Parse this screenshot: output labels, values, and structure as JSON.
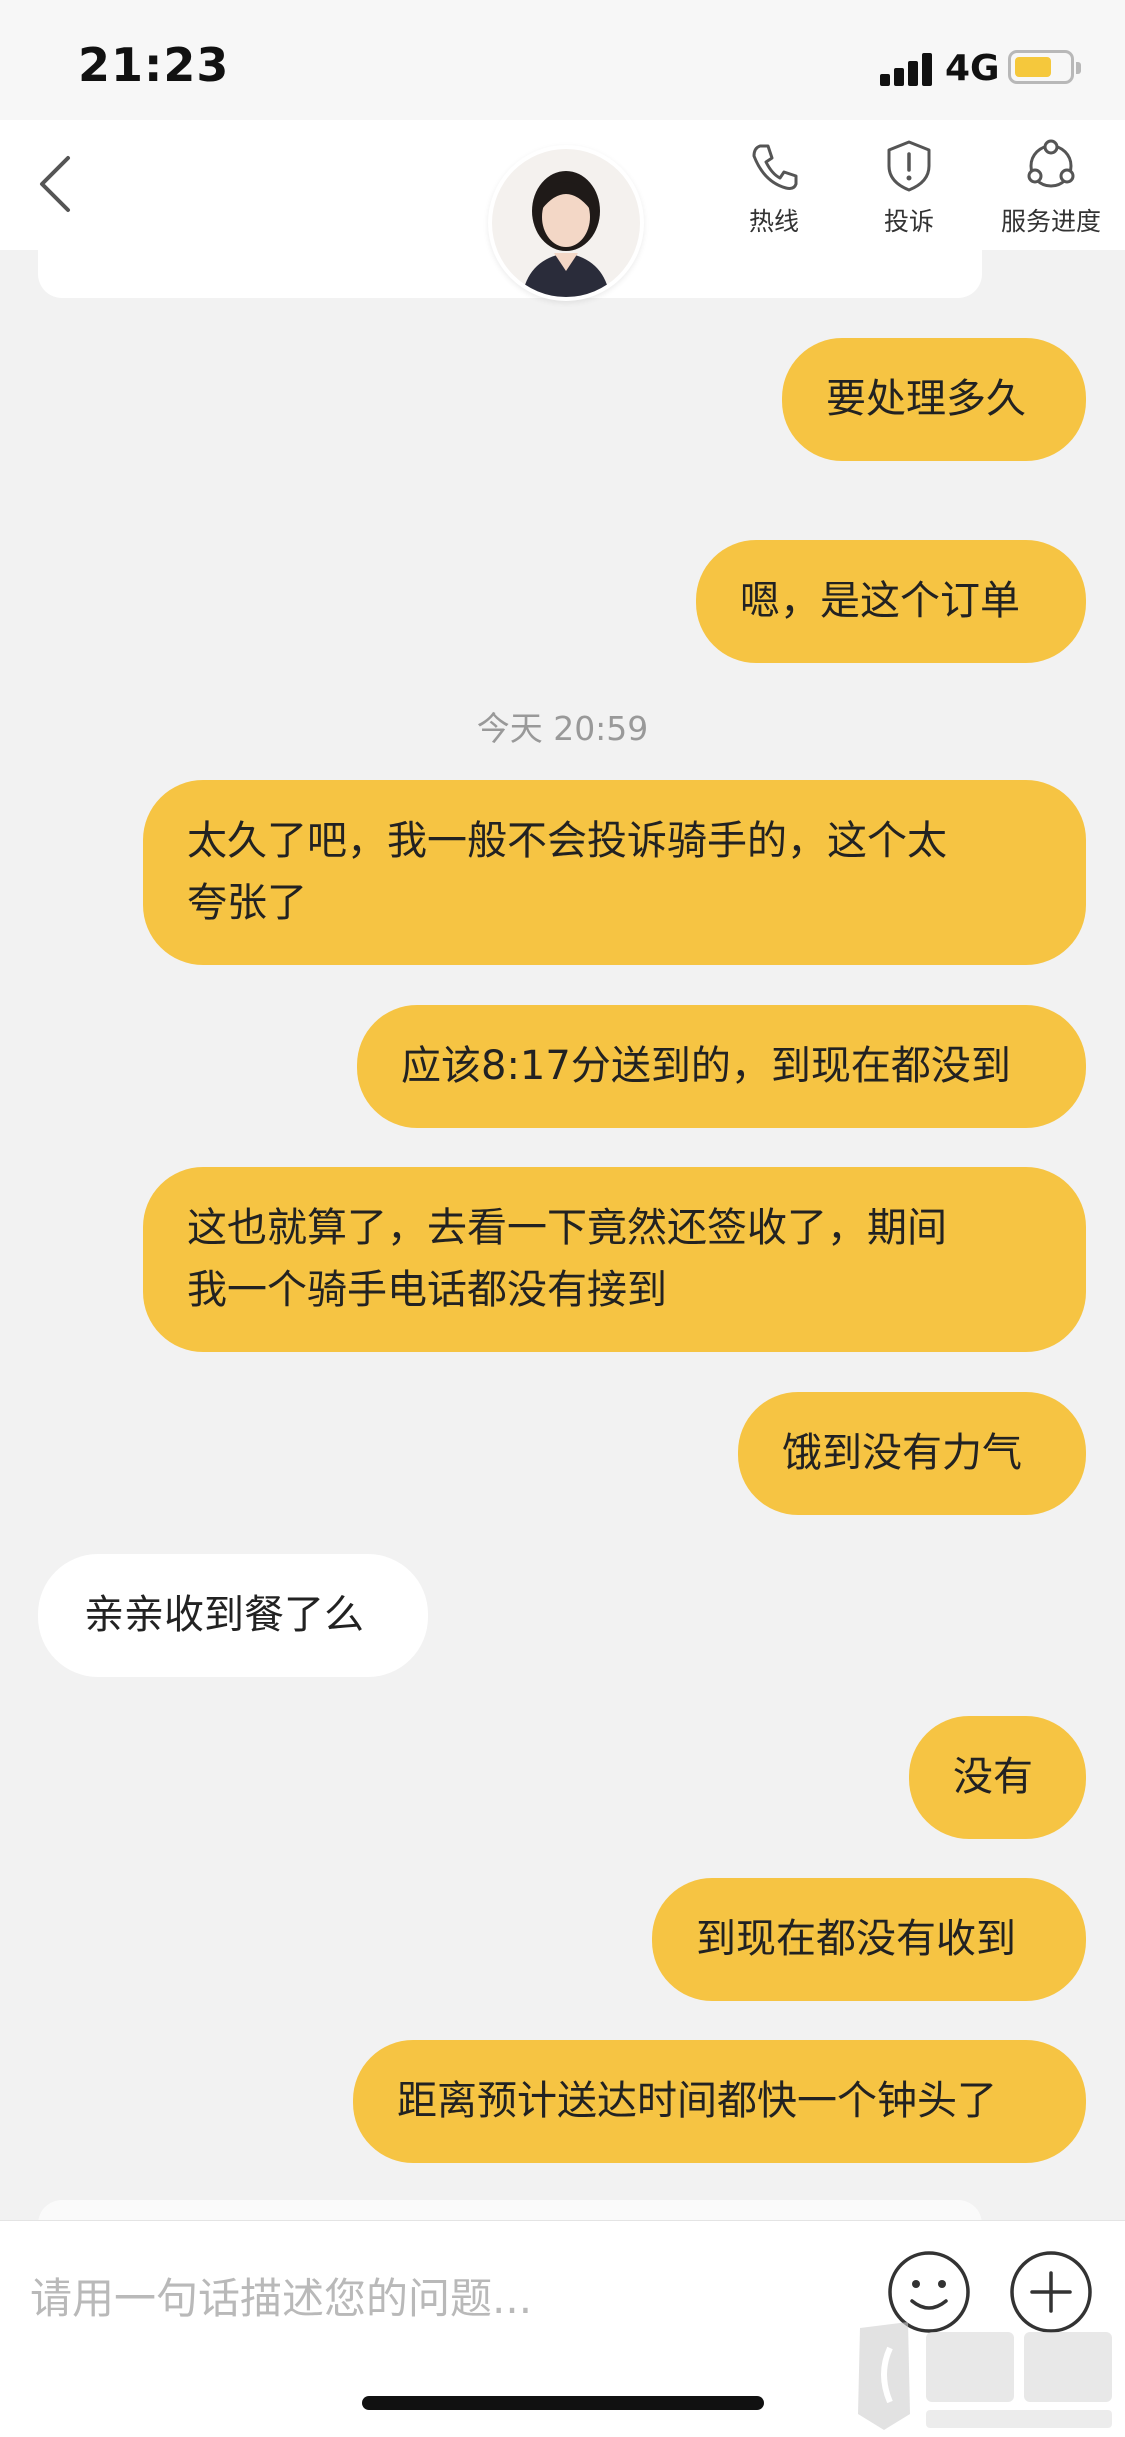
{
  "status_bar": {
    "time": "21:23",
    "network": "4G",
    "battery_level": 0.55
  },
  "nav": {
    "buttons": [
      {
        "label": "热线",
        "icon": "phone-icon"
      },
      {
        "label": "投诉",
        "icon": "shield-icon"
      },
      {
        "label": "服务进度",
        "icon": "progress-icon"
      }
    ]
  },
  "chat": {
    "timestamp": "今天 20:59",
    "messages": [
      {
        "from": "me",
        "text": "要处理多久"
      },
      {
        "from": "me",
        "text": "嗯，是这个订单"
      },
      {
        "from": "me",
        "line1": "太久了吧，我一般不会投诉骑手的，这个太",
        "line2": "夸张了"
      },
      {
        "from": "me",
        "text": "应该8:17分送到的，到现在都没到"
      },
      {
        "from": "me",
        "line1": "这也就算了，去看一下竟然还签收了，期间",
        "line2": "我一个骑手电话都没有接到"
      },
      {
        "from": "me",
        "text": "饿到没有力气"
      },
      {
        "from": "agent",
        "text": "亲亲收到餐了么"
      },
      {
        "from": "me",
        "text": "没有"
      },
      {
        "from": "me",
        "text": "到现在都没有收到"
      },
      {
        "from": "me",
        "text": "距离预计送达时间都快一个钟头了"
      }
    ]
  },
  "input": {
    "placeholder": "请用一句话描述您的问题..."
  },
  "colors": {
    "my_bubble": "#f6c443",
    "agent_bubble": "#ffffff",
    "background": "#f2f2f2"
  }
}
